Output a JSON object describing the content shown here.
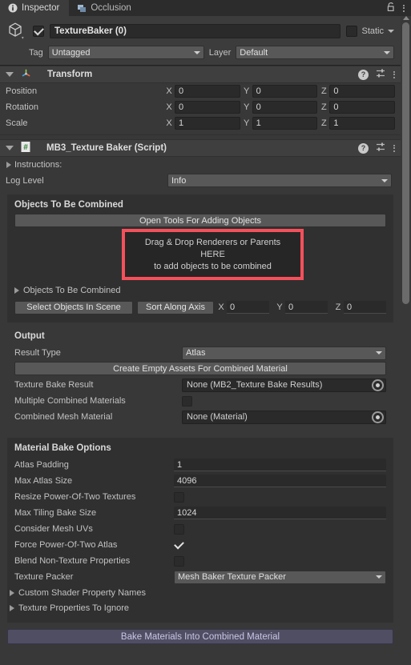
{
  "tabs": [
    {
      "label": "Inspector",
      "icon": "info-icon",
      "active": true
    },
    {
      "label": "Occlusion",
      "icon": "occlusion-icon",
      "active": false
    }
  ],
  "tabbar_right": {
    "lock": "lock-icon",
    "menu": "kebab-menu-icon"
  },
  "gameobject": {
    "icon": "cube-icon",
    "enabled": true,
    "name": "TextureBaker (0)",
    "static_label": "Static",
    "static_checked": false,
    "tag_label": "Tag",
    "tag_value": "Untagged",
    "layer_label": "Layer",
    "layer_value": "Default"
  },
  "transform": {
    "title": "Transform",
    "icon": "transform-gizmo-icon",
    "rows": [
      {
        "label": "Position",
        "x": "0",
        "y": "0",
        "z": "0"
      },
      {
        "label": "Rotation",
        "x": "0",
        "y": "0",
        "z": "0"
      },
      {
        "label": "Scale",
        "x": "1",
        "y": "1",
        "z": "1"
      }
    ],
    "axis_labels": {
      "x": "X",
      "y": "Y",
      "z": "Z"
    }
  },
  "script": {
    "title": "MB3_Texture Baker (Script)",
    "icon": "cs-script-icon",
    "instructions_label": "Instructions:",
    "log_level_label": "Log Level",
    "log_level_value": "Info",
    "objects_panel": {
      "title": "Objects To Be Combined",
      "open_tools_button": "Open Tools For Adding Objects",
      "dnd_line1": "Drag & Drop Renderers or Parents",
      "dnd_line2": "HERE",
      "dnd_line3": "to add objects to be combined",
      "dnd_highlight_color": "#f4505c",
      "list_foldout": "Objects To Be Combined",
      "select_button": "Select Objects In Scene",
      "sort_button": "Sort Along Axis",
      "sort_x_label": "X",
      "sort_x": "0",
      "sort_y_label": "Y",
      "sort_y": "0",
      "sort_z_label": "Z",
      "sort_z": "0"
    },
    "output_panel": {
      "title": "Output",
      "result_type_label": "Result Type",
      "result_type_value": "Atlas",
      "create_assets_button": "Create Empty Assets For Combined Material",
      "texture_bake_result_label": "Texture Bake Result",
      "texture_bake_result_value": "None (MB2_Texture Bake Results)",
      "multiple_materials_label": "Multiple Combined Materials",
      "multiple_materials_checked": false,
      "combined_mesh_material_label": "Combined Mesh Material",
      "combined_mesh_material_value": "None (Material)"
    },
    "material_panel": {
      "title": "Material Bake Options",
      "atlas_padding_label": "Atlas Padding",
      "atlas_padding_value": "1",
      "max_atlas_size_label": "Max Atlas Size",
      "max_atlas_size_value": "4096",
      "resize_pot_label": "Resize Power-Of-Two Textures",
      "resize_pot_checked": false,
      "max_tiling_label": "Max Tiling Bake Size",
      "max_tiling_value": "1024",
      "consider_uvs_label": "Consider Mesh UVs",
      "consider_uvs_checked": false,
      "force_pot_label": "Force Power-Of-Two Atlas",
      "force_pot_checked": true,
      "blend_non_texture_label": "Blend Non-Texture Properties",
      "blend_non_texture_checked": false,
      "texture_packer_label": "Texture Packer",
      "texture_packer_value": "Mesh Baker Texture Packer",
      "custom_shader_foldout": "Custom Shader Property Names",
      "texture_props_foldout": "Texture Properties To Ignore"
    },
    "bake_button": "Bake Materials Into Combined Material"
  }
}
